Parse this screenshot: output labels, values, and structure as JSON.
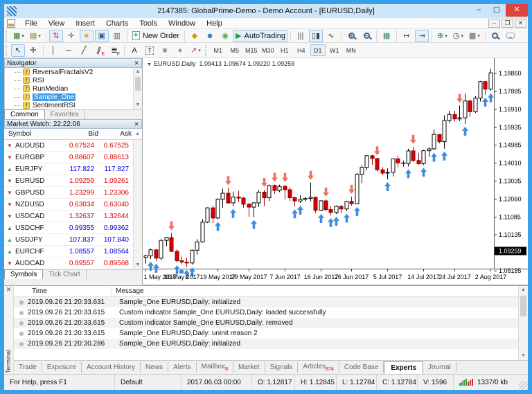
{
  "window": {
    "title": "2147385: GlobalPrime-Demo - Demo Account - [EURUSD,Daily]",
    "controls": {
      "minimize": "–",
      "maximize": "▢",
      "close": "✕"
    },
    "mdi_controls": {
      "minimize": "–",
      "restore": "❐",
      "close": "✕"
    }
  },
  "menu": {
    "items": [
      "File",
      "View",
      "Insert",
      "Charts",
      "Tools",
      "Window",
      "Help"
    ]
  },
  "toolbar1": [
    {
      "n": "new-chart",
      "g": "▦",
      "c": "#2E7D32",
      "dd": 1
    },
    {
      "n": "profiles",
      "g": "▤",
      "c": "#8A6D1A",
      "dd": 1
    },
    {
      "sep": 1
    },
    {
      "n": "market-watch-toggle",
      "g": "⇅",
      "c": "#C23B2A",
      "on": 1
    },
    {
      "n": "data-window",
      "g": "✛",
      "c": "#555555"
    },
    {
      "n": "navigator-toggle",
      "g": "★",
      "c": "#E3A600",
      "on": 1
    },
    {
      "n": "terminal-toggle",
      "g": "▣",
      "c": "#33589E",
      "on": 1
    },
    {
      "n": "strategy-tester",
      "g": "▥",
      "c": "#556677"
    },
    {
      "sep": 1
    },
    {
      "n": "new-order",
      "css": "docplus",
      "label": "New Order"
    },
    {
      "sep": 1
    },
    {
      "n": "scripts",
      "g": "◆",
      "c": "#D09A12"
    },
    {
      "n": "expert-advisors",
      "g": "☻",
      "c": "#3A6FC4"
    },
    {
      "n": "signals",
      "g": "◉",
      "c": "#57A557"
    },
    {
      "n": "autotrading",
      "g": "▶",
      "c": "#1E9E40",
      "label": "AutoTrading",
      "on": 1
    },
    {
      "sep": 1
    },
    {
      "n": "bar-chart",
      "g": "|||",
      "c": "#444444"
    },
    {
      "n": "candle-chart",
      "g": "▯▮",
      "c": "#444444",
      "on": 1
    },
    {
      "n": "line-chart",
      "g": "∿",
      "c": "#444444"
    },
    {
      "sep": 1
    },
    {
      "n": "zoom-in",
      "css": "mag",
      "g": "+"
    },
    {
      "n": "zoom-out",
      "css": "mag",
      "g": "−"
    },
    {
      "sep": 1
    },
    {
      "n": "tile-windows",
      "g": "▦",
      "c": "#2E8B57"
    },
    {
      "sep": 1
    },
    {
      "n": "auto-scroll",
      "g": "↦",
      "c": "#445566"
    },
    {
      "n": "chart-shift",
      "g": "⇥",
      "c": "#445566",
      "on": 1
    },
    {
      "sep": 1
    },
    {
      "n": "indicators",
      "g": "⊕",
      "c": "#2E7D32",
      "dd": 1
    },
    {
      "n": "periods",
      "g": "◷",
      "c": "#334455",
      "dd": 1
    },
    {
      "n": "templates",
      "g": "▩",
      "c": "#556677",
      "dd": 1
    },
    {
      "sep": 1
    },
    {
      "n": "search",
      "css": "mag",
      "g": ""
    },
    {
      "n": "chat",
      "css": "bubble",
      "g": ""
    }
  ],
  "toolbar2": {
    "tools": [
      {
        "n": "cursor",
        "g": "↖",
        "c": "#222222",
        "on": 1
      },
      {
        "n": "crosshair",
        "g": "✛",
        "c": "#222222"
      },
      {
        "sep": 1
      },
      {
        "n": "vertical-line",
        "g": "│",
        "c": "#222222"
      },
      {
        "n": "horizontal-line",
        "g": "─",
        "c": "#222222"
      },
      {
        "n": "trendline",
        "g": "╱",
        "c": "#222222"
      },
      {
        "n": "channel",
        "g": "∥",
        "c": "#222222",
        "cls": "slant",
        "sub": "E"
      },
      {
        "n": "fibonacci",
        "g": "≣",
        "c": "#222222",
        "sub": "F"
      },
      {
        "sep": 1
      },
      {
        "n": "text",
        "g": "A",
        "c": "#222222"
      },
      {
        "n": "label",
        "g": "T",
        "c": "#222222",
        "cls": "dashed-box"
      },
      {
        "n": "rectangle",
        "g": "■",
        "c": "#8899AA"
      },
      {
        "n": "ellipse",
        "g": "●",
        "c": "#8899AA"
      },
      {
        "n": "arrows",
        "g": "↗",
        "c": "#C23B2A",
        "dd": 1
      }
    ],
    "timeframes": [
      "M1",
      "M5",
      "M15",
      "M30",
      "H1",
      "H4",
      "D1",
      "W1",
      "MN"
    ],
    "active_timeframe": "D1"
  },
  "navigator": {
    "title": "Navigator",
    "close": "✕",
    "items": [
      "ReversalFractalsV2",
      "RSI",
      "RunMedian",
      "Sample_One",
      "SentimentRSI"
    ],
    "selected": "Sample_One",
    "tabs": [
      "Common",
      "Favorites"
    ],
    "active_tab": "Common"
  },
  "market_watch": {
    "title": "Market Watch: 22:22:06",
    "close": "✕",
    "columns": [
      "Symbol",
      "Bid",
      "Ask"
    ],
    "rows": [
      {
        "symbol": "AUDUSD",
        "bid": "0.67524",
        "ask": "0.67525",
        "dir": "down"
      },
      {
        "symbol": "EURGBP",
        "bid": "0.88607",
        "ask": "0.88613",
        "dir": "down"
      },
      {
        "symbol": "EURJPY",
        "bid": "117.822",
        "ask": "117.827",
        "dir": "up"
      },
      {
        "symbol": "EURUSD",
        "bid": "1.09259",
        "ask": "1.09261",
        "dir": "down"
      },
      {
        "symbol": "GBPUSD",
        "bid": "1.23299",
        "ask": "1.23306",
        "dir": "down"
      },
      {
        "symbol": "NZDUSD",
        "bid": "0.63034",
        "ask": "0.63040",
        "dir": "down"
      },
      {
        "symbol": "USDCAD",
        "bid": "1.32637",
        "ask": "1.32644",
        "dir": "down"
      },
      {
        "symbol": "USDCHF",
        "bid": "0.99355",
        "ask": "0.99362",
        "dir": "up"
      },
      {
        "symbol": "USDJPY",
        "bid": "107.837",
        "ask": "107.840",
        "dir": "up"
      },
      {
        "symbol": "EURCHF",
        "bid": "1.08557",
        "ask": "1.08564",
        "dir": "up"
      },
      {
        "symbol": "AUDCAD",
        "bid": "0.89557",
        "ask": "0.89568",
        "dir": "down"
      }
    ],
    "tabs": [
      "Symbols",
      "Tick Chart"
    ],
    "active_tab": "Symbols"
  },
  "chart": {
    "marker": "▼",
    "title": "EURUSD,Daily",
    "ohlc_line": "1.09413 1.09674 1.09220 1.09259"
  },
  "chart_data": {
    "type": "candlestick",
    "symbol": "EURUSD",
    "timeframe": "Daily",
    "ylim": [
      1.08302,
      1.19684
    ],
    "price_labels": [
      "1.18860",
      "1.17885",
      "1.16910",
      "1.15935",
      "1.14985",
      "1.14010",
      "1.13035",
      "1.12060",
      "1.11085",
      "1.10135",
      "1.08185"
    ],
    "current_price": "1.09259",
    "x_labels": [
      {
        "i": 0,
        "t": "1 May 2017"
      },
      {
        "i": 7,
        "t": "10 May 2017"
      },
      {
        "i": 14,
        "t": "19 May 2017"
      },
      {
        "i": 20,
        "t": "29 May 2017"
      },
      {
        "i": 27,
        "t": "7 Jun 2017"
      },
      {
        "i": 34,
        "t": "16 Jun 2017"
      },
      {
        "i": 40,
        "t": "26 Jun 2017"
      },
      {
        "i": 47,
        "t": "5 Jul 2017"
      },
      {
        "i": 54,
        "t": "14 Jul 2017"
      },
      {
        "i": 60,
        "t": "24 Jul 2017"
      },
      {
        "i": 67,
        "t": "2 Aug 2017"
      }
    ],
    "candles": [
      [
        1.089,
        1.0905,
        1.0858,
        1.0899
      ],
      [
        1.0899,
        1.0939,
        1.0883,
        1.0932
      ],
      [
        1.0932,
        1.0936,
        1.0872,
        1.0887
      ],
      [
        1.0887,
        1.099,
        1.0877,
        1.0983
      ],
      [
        1.0983,
        1.1001,
        1.0952,
        1.0998
      ],
      [
        1.0998,
        1.1023,
        1.092,
        1.0924
      ],
      [
        1.0924,
        1.0935,
        1.0864,
        1.0873
      ],
      [
        1.0873,
        1.0896,
        1.0853,
        1.0866
      ],
      [
        1.0866,
        1.089,
        1.0839,
        1.0861
      ],
      [
        1.0861,
        1.0934,
        1.0852,
        1.093
      ],
      [
        1.093,
        1.099,
        1.0905,
        1.0975
      ],
      [
        1.0975,
        1.1098,
        1.0971,
        1.1082
      ],
      [
        1.1082,
        1.1162,
        1.1077,
        1.1159
      ],
      [
        1.1159,
        1.1172,
        1.1077,
        1.1104
      ],
      [
        1.1104,
        1.1211,
        1.1098,
        1.1205
      ],
      [
        1.1205,
        1.1263,
        1.116,
        1.1238
      ],
      [
        1.1238,
        1.1267,
        1.118,
        1.1186
      ],
      [
        1.1186,
        1.1247,
        1.1168,
        1.1218
      ],
      [
        1.1218,
        1.1251,
        1.1191,
        1.1212
      ],
      [
        1.1212,
        1.1217,
        1.116,
        1.1179
      ],
      [
        1.1179,
        1.1186,
        1.111,
        1.1163
      ],
      [
        1.1163,
        1.119,
        1.1109,
        1.1186
      ],
      [
        1.1186,
        1.1254,
        1.1164,
        1.1244
      ],
      [
        1.1244,
        1.1257,
        1.1168,
        1.1214
      ],
      [
        1.1214,
        1.1285,
        1.1197,
        1.128
      ],
      [
        1.128,
        1.1285,
        1.1235,
        1.1253
      ],
      [
        1.1253,
        1.1284,
        1.1244,
        1.1275
      ],
      [
        1.1275,
        1.1284,
        1.1204,
        1.1257
      ],
      [
        1.1257,
        1.127,
        1.1196,
        1.1214
      ],
      [
        1.1214,
        1.1221,
        1.1166,
        1.1196
      ],
      [
        1.1196,
        1.1228,
        1.1186,
        1.1205
      ],
      [
        1.1205,
        1.1218,
        1.1192,
        1.121
      ],
      [
        1.121,
        1.1296,
        1.1193,
        1.1216
      ],
      [
        1.1216,
        1.122,
        1.1131,
        1.1146
      ],
      [
        1.1146,
        1.1201,
        1.1141,
        1.1197
      ],
      [
        1.1197,
        1.1205,
        1.1141,
        1.115
      ],
      [
        1.115,
        1.1169,
        1.1119,
        1.1134
      ],
      [
        1.1134,
        1.1172,
        1.1126,
        1.1167
      ],
      [
        1.1167,
        1.1174,
        1.1129,
        1.1153
      ],
      [
        1.1153,
        1.1197,
        1.1143,
        1.1194
      ],
      [
        1.1194,
        1.122,
        1.1171,
        1.1181
      ],
      [
        1.1181,
        1.1348,
        1.1179,
        1.134
      ],
      [
        1.134,
        1.139,
        1.1292,
        1.1378
      ],
      [
        1.1378,
        1.1445,
        1.1362,
        1.1441
      ],
      [
        1.1441,
        1.1445,
        1.1392,
        1.1426
      ],
      [
        1.1426,
        1.1428,
        1.1357,
        1.1365
      ],
      [
        1.1365,
        1.1379,
        1.1336,
        1.1347
      ],
      [
        1.1347,
        1.1372,
        1.1313,
        1.1351
      ],
      [
        1.1351,
        1.1426,
        1.1329,
        1.1424
      ],
      [
        1.1424,
        1.144,
        1.1379,
        1.1402
      ],
      [
        1.1402,
        1.1415,
        1.1382,
        1.1399
      ],
      [
        1.1399,
        1.1479,
        1.1383,
        1.1467
      ],
      [
        1.1467,
        1.149,
        1.1408,
        1.1415
      ],
      [
        1.1415,
        1.1455,
        1.1392,
        1.1398
      ],
      [
        1.1398,
        1.1472,
        1.1391,
        1.1468
      ],
      [
        1.1468,
        1.1487,
        1.1435,
        1.1478
      ],
      [
        1.1478,
        1.1583,
        1.1472,
        1.1556
      ],
      [
        1.1556,
        1.1558,
        1.1509,
        1.1517
      ],
      [
        1.1517,
        1.1659,
        1.1479,
        1.1631
      ],
      [
        1.1631,
        1.1684,
        1.1618,
        1.1664
      ],
      [
        1.1664,
        1.1684,
        1.1625,
        1.164
      ],
      [
        1.164,
        1.1712,
        1.1628,
        1.1646
      ],
      [
        1.1646,
        1.1777,
        1.1613,
        1.1737
      ],
      [
        1.1737,
        1.1745,
        1.1651,
        1.1679
      ],
      [
        1.1679,
        1.1764,
        1.1672,
        1.1752
      ],
      [
        1.1752,
        1.1846,
        1.1734,
        1.1842
      ],
      [
        1.1842,
        1.1846,
        1.177,
        1.1801
      ],
      [
        1.1801,
        1.191,
        1.1793,
        1.1889
      ]
    ],
    "up_arrows": [
      1,
      2,
      6,
      8,
      9,
      14,
      17,
      21,
      29,
      30,
      34,
      36,
      37,
      39,
      41,
      47,
      51,
      54,
      56,
      58,
      62,
      66,
      67
    ],
    "down_arrows": [
      5,
      16,
      23,
      25,
      27,
      32,
      35,
      40,
      45,
      52,
      61
    ],
    "colors": {
      "bull": "#FFFFFF",
      "bear": "#D60000",
      "wick_bull": "#000000",
      "wick_bear": "#B00000",
      "up_arrow": "#3D8DDE",
      "down_arrow": "#F07060",
      "price_box_bg": "#000000",
      "price_box_fg": "#FFFFFF"
    }
  },
  "terminal": {
    "side_label": "Terminal",
    "close": "✕",
    "columns": {
      "time": "Time",
      "message": "Message"
    },
    "rows": [
      {
        "time": "2019.09.26 21:20:33.631",
        "message": "Sample_One EURUSD,Daily: initialized"
      },
      {
        "time": "2019.09.26 21:20:33.615",
        "message": "Custom indicator Sample_One EURUSD,Daily: loaded successfully"
      },
      {
        "time": "2019.09.26 21:20:33.615",
        "message": "Custom indicator Sample_One EURUSD,Daily: removed"
      },
      {
        "time": "2019.09.26 21:20:33.615",
        "message": "Sample_One EURUSD,Daily: uninit reason 2"
      },
      {
        "time": "2019.09.26 21:20:30.286",
        "message": "Sample_One EURUSD,Daily: initialized"
      }
    ],
    "tabs": [
      {
        "label": "Trade"
      },
      {
        "label": "Exposure"
      },
      {
        "label": "Account History"
      },
      {
        "label": "News"
      },
      {
        "label": "Alerts"
      },
      {
        "label": "Mailbox",
        "badge": "8"
      },
      {
        "label": "Market"
      },
      {
        "label": "Signals"
      },
      {
        "label": "Articles",
        "badge": "874"
      },
      {
        "label": "Code Base"
      },
      {
        "label": "Experts"
      },
      {
        "label": "Journal"
      }
    ],
    "active_tab": "Experts"
  },
  "status_bar": {
    "help": "For Help, press F1",
    "profile": "Default",
    "bar_time": "2017.06.03 00:00",
    "o": "O: 1.12817",
    "h": "H: 1.12845",
    "l": "L: 1.12784",
    "c": "C: 1.12784",
    "v": "V: 1596",
    "traffic": "1337/0 kb"
  }
}
